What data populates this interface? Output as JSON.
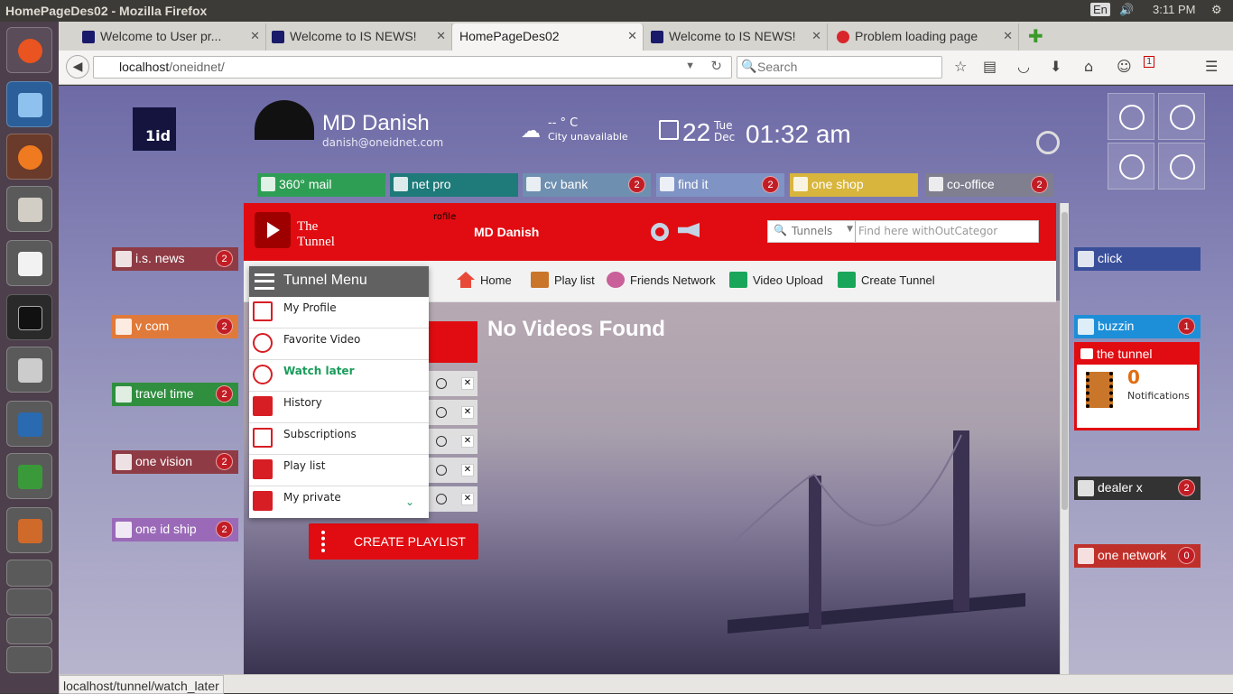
{
  "os": {
    "window_title": "HomePageDes02 - Mozilla Firefox",
    "keyboard": "En",
    "clock": "3:11 PM"
  },
  "browser": {
    "tabs": [
      {
        "label": "Welcome to User pr..."
      },
      {
        "label": "Welcome to IS NEWS!"
      },
      {
        "label": "HomePageDes02"
      },
      {
        "label": "Welcome to IS NEWS!"
      },
      {
        "label": "Problem loading page"
      }
    ],
    "url_host": "localhost",
    "url_path": "/oneidnet/",
    "search_placeholder": "Search",
    "status_url": "localhost/tunnel/watch_later",
    "notification_count": "1"
  },
  "page": {
    "logo_text": "1id",
    "user": {
      "name": "MD Danish",
      "email": "danish@oneidnet.com"
    },
    "weather": {
      "temp": "-- ° C",
      "city": "City unavailable"
    },
    "date": {
      "day": "22",
      "dayname": "Tue",
      "month": "Dec"
    },
    "time": "01:32 am",
    "apps_top": [
      {
        "label": "360° mail",
        "color": "#2f9e55"
      },
      {
        "label": "net pro",
        "color": "#1f7a7a"
      },
      {
        "label": "cv bank",
        "color": "#6f8fb0",
        "badge": "2"
      },
      {
        "label": "find it",
        "color": "#7f94c4",
        "badge": "2"
      },
      {
        "label": "one shop",
        "color": "#d8b53d"
      },
      {
        "label": "co-office",
        "color": "#7f7f8f",
        "badge": "2"
      }
    ],
    "apps_left": [
      {
        "label": "i.s. news",
        "color": "#8e3b45",
        "badge": "2"
      },
      {
        "label": "v com",
        "color": "#e07a3a",
        "badge": "2"
      },
      {
        "label": "travel time",
        "color": "#2f8f3f",
        "badge": "2"
      },
      {
        "label": "one vision",
        "color": "#8e3b45",
        "badge": "2"
      },
      {
        "label": "one id ship",
        "color": "#9a6ab8",
        "badge": "2"
      }
    ],
    "apps_right": [
      {
        "label": "click",
        "color": "#3a4f9a"
      },
      {
        "label": "buzzin",
        "color": "#1d8fd8",
        "badge": "1"
      },
      {
        "label": "dealer x",
        "color": "#333333",
        "badge": "2"
      },
      {
        "label": "one network",
        "color": "#c0302a",
        "badge": "0"
      }
    ],
    "notification": {
      "title": "the tunnel",
      "count": "0",
      "label": "Notifications"
    }
  },
  "tunnel": {
    "title_line1": "The",
    "title_line2": "Tunnel",
    "profile_label": "rofile",
    "user": "MD Danish",
    "search_category": "Tunnels",
    "search_placeholder": "Find here withOutCategor",
    "nav": [
      "Home",
      "Play list",
      "Friends Network",
      "Video Upload",
      "Create Tunnel"
    ],
    "menu_title": "Tunnel Menu",
    "menu": [
      "My Profile",
      "Favorite Video",
      "Watch later",
      "History",
      "Subscriptions",
      "Play list",
      "My private"
    ],
    "empty_message": "No Videos Found",
    "create_button": "CREATE PLAYLIST"
  }
}
